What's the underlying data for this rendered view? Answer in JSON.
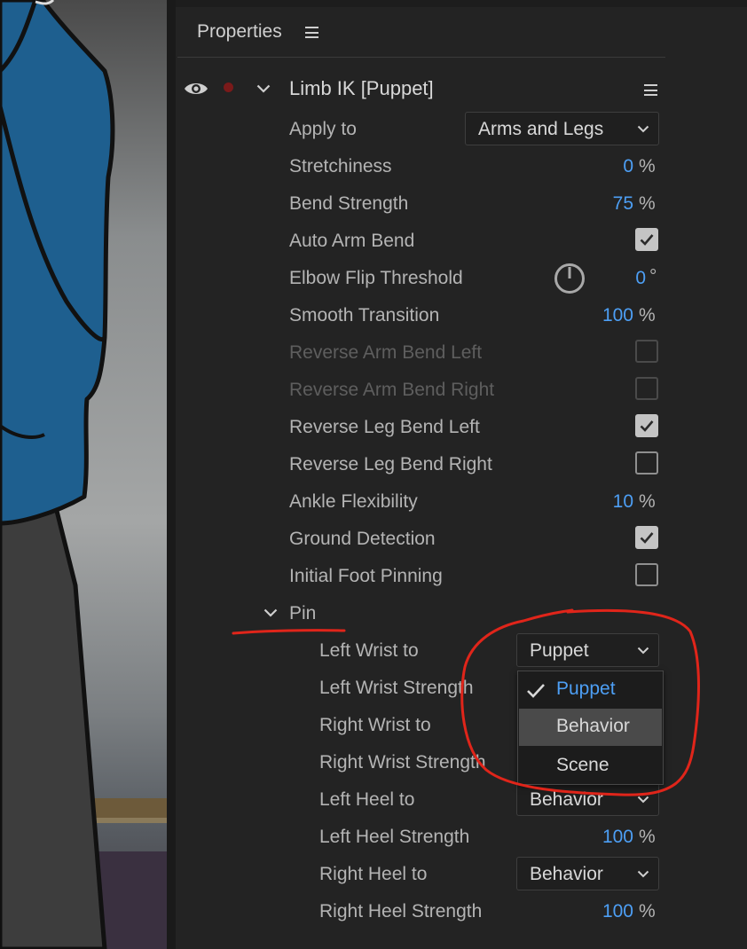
{
  "panel": {
    "title": "Properties"
  },
  "behavior": {
    "title": "Limb IK [Puppet]"
  },
  "rows": [
    {
      "label": "Apply to",
      "dropdown": "Arms and Legs"
    },
    {
      "label": "Stretchiness",
      "value": "0",
      "unit": "%"
    },
    {
      "label": "Bend Strength",
      "value": "75",
      "unit": "%"
    },
    {
      "label": "Auto Arm Bend",
      "checked": true
    },
    {
      "label": "Elbow Flip Threshold",
      "value": "0",
      "unit": "°"
    },
    {
      "label": "Smooth Transition",
      "value": "100",
      "unit": "%"
    },
    {
      "label": "Reverse Arm Bend Left",
      "checked": false,
      "disabled": true
    },
    {
      "label": "Reverse Arm Bend Right",
      "checked": false,
      "disabled": true
    },
    {
      "label": "Reverse Leg Bend Left",
      "checked": true
    },
    {
      "label": "Reverse Leg Bend Right",
      "checked": false
    },
    {
      "label": "Ankle Flexibility",
      "value": "10",
      "unit": "%"
    },
    {
      "label": "Ground Detection",
      "checked": true
    },
    {
      "label": "Initial Foot Pinning",
      "checked": false
    }
  ],
  "pin": {
    "label": "Pin",
    "rows": [
      {
        "label": "Left Wrist to",
        "dropdown": "Puppet"
      },
      {
        "label": "Left Wrist Strength"
      },
      {
        "label": "Right Wrist to"
      },
      {
        "label": "Right Wrist Strength"
      },
      {
        "label": "Left Heel to",
        "dropdown": "Behavior"
      },
      {
        "label": "Left Heel Strength",
        "value": "100",
        "unit": "%"
      },
      {
        "label": "Right Heel to",
        "dropdown": "Behavior"
      },
      {
        "label": "Right Heel Strength",
        "value": "100",
        "unit": "%"
      }
    ]
  },
  "menu": {
    "options": [
      "Puppet",
      "Behavior",
      "Scene"
    ],
    "selected": "Puppet",
    "highlighted": "Behavior"
  },
  "colors": {
    "accent": "#4d9ff5",
    "annotation": "#e0251a",
    "shirt": "#1e5f8f"
  },
  "icons": [
    "eye-icon",
    "record-icon",
    "chevron-down-icon",
    "hamburger-icon",
    "knob-icon",
    "checkmark-icon"
  ]
}
